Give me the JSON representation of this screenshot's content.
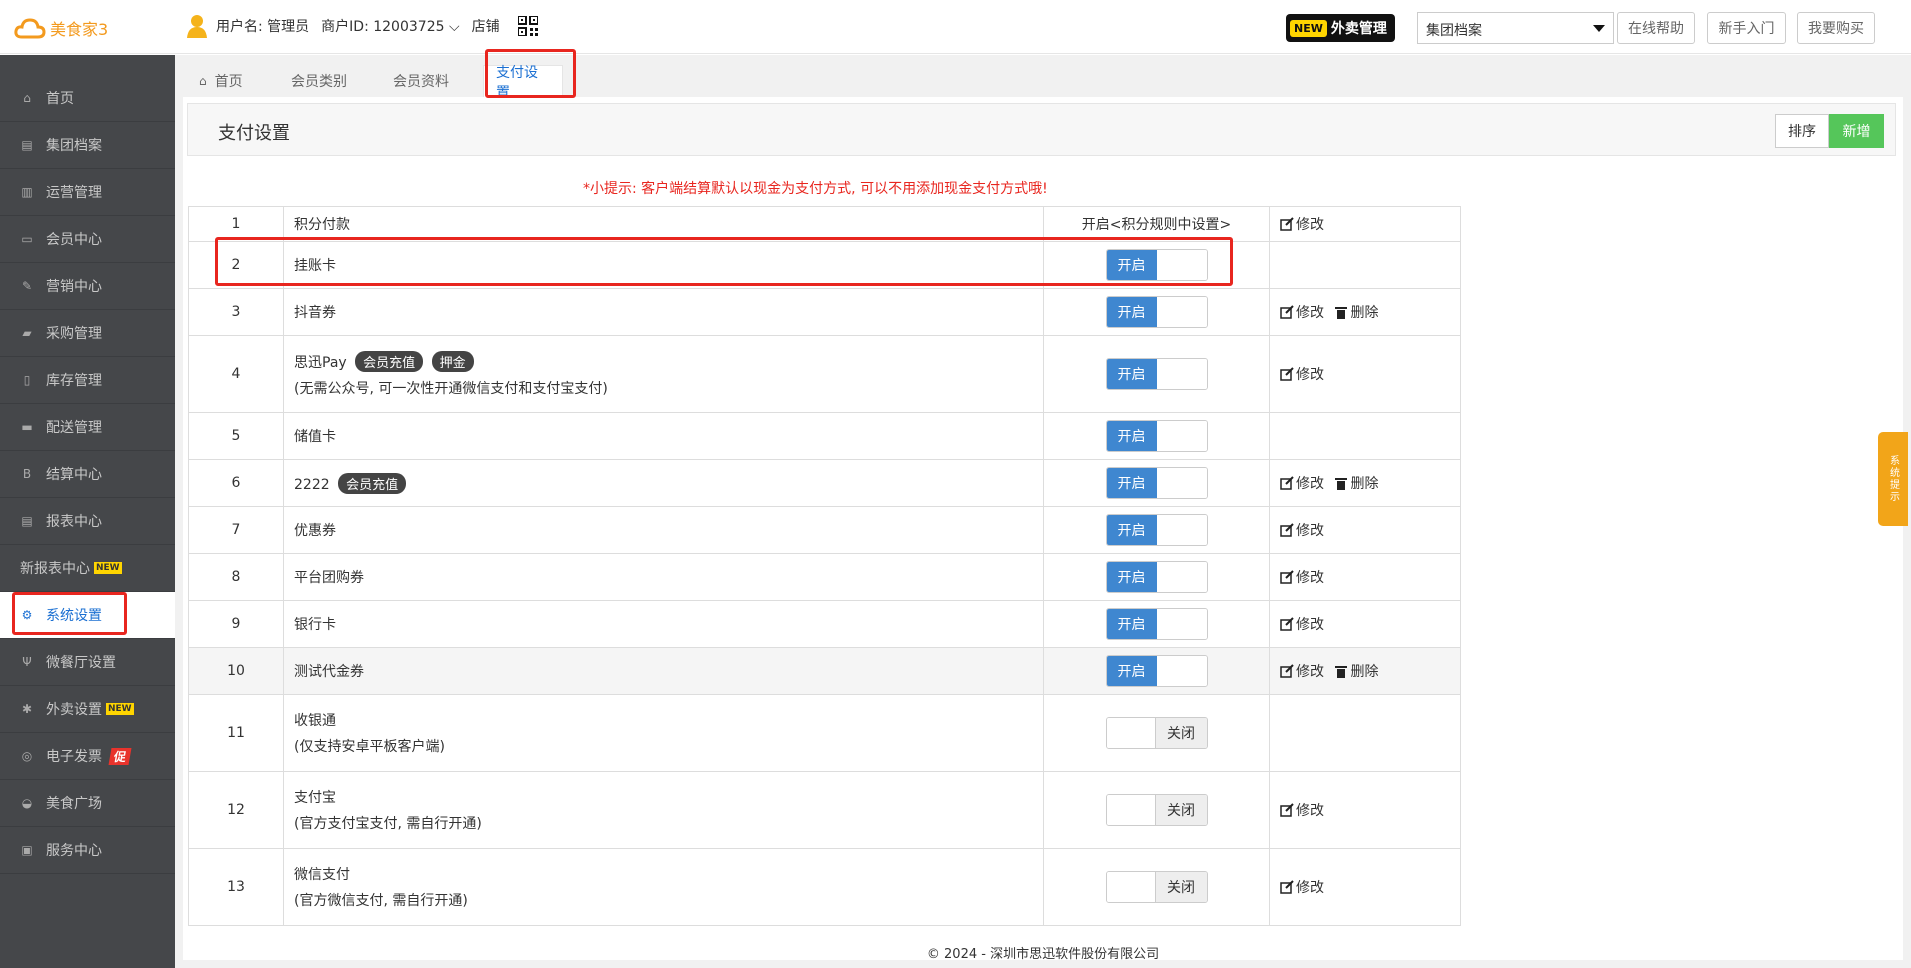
{
  "header": {
    "brand": "美食家3",
    "username_label": "用户名: 管理员",
    "merchant_label": "商户ID: 12003725 ⌵",
    "store_label": "店铺",
    "waimai_new": "NEW",
    "waimai_label": "外卖管理",
    "select_value": "集团档案",
    "help_label": "在线帮助",
    "intro_label": "新手入门",
    "buy_label": "我要购买"
  },
  "sidebar": {
    "items": [
      {
        "label": "首页",
        "icon": "home-icon"
      },
      {
        "label": "集团档案",
        "icon": "doc-icon"
      },
      {
        "label": "运营管理",
        "icon": "chart-icon"
      },
      {
        "label": "会员中心",
        "icon": "card-icon"
      },
      {
        "label": "营销中心",
        "icon": "edit-icon"
      },
      {
        "label": "采购管理",
        "icon": "book-icon"
      },
      {
        "label": "库存管理",
        "icon": "box-icon"
      },
      {
        "label": "配送管理",
        "icon": "truck-icon"
      },
      {
        "label": "结算中心",
        "icon": "coin-icon"
      },
      {
        "label": "报表中心",
        "icon": "report-icon"
      },
      {
        "label": "新报表中心",
        "badge": "NEW"
      },
      {
        "label": "系统设置",
        "icon": "gear-icon"
      },
      {
        "label": "微餐厅设置",
        "icon": "fork-icon"
      },
      {
        "label": "外卖设置",
        "icon": "cog-icon",
        "badge": "NEW"
      },
      {
        "label": "电子发票",
        "icon": "invoice-icon",
        "badge": "促"
      },
      {
        "label": "美食广场",
        "icon": "bowl-icon"
      },
      {
        "label": "服务中心",
        "icon": "service-icon"
      }
    ]
  },
  "tabs": [
    {
      "label": "首页"
    },
    {
      "label": "会员类别"
    },
    {
      "label": "会员资料"
    },
    {
      "label": "支付设置"
    }
  ],
  "panel": {
    "title": "支付设置",
    "sort_label": "排序",
    "add_label": "新增",
    "tip": "*小提示: 客户端结算默认以现金为支付方式, 可以不用添加现金支付方式哦!"
  },
  "labels": {
    "on": "开启",
    "off": "关闭",
    "edit": "修改",
    "delete": "删除"
  },
  "rows": [
    {
      "no": "1",
      "name": "积分付款",
      "status_text": "开启<积分规则中设置>"
    },
    {
      "no": "2",
      "name": "挂账卡"
    },
    {
      "no": "3",
      "name": "抖音券"
    },
    {
      "no": "4",
      "name": "思迅Pay",
      "tags": [
        "会员充值",
        "押金"
      ],
      "sub": "(无需公众号, 可一次性开通微信支付和支付宝支付)"
    },
    {
      "no": "5",
      "name": "储值卡"
    },
    {
      "no": "6",
      "name": "2222",
      "tags": [
        "会员充值"
      ]
    },
    {
      "no": "7",
      "name": "优惠券"
    },
    {
      "no": "8",
      "name": "平台团购券"
    },
    {
      "no": "9",
      "name": "银行卡"
    },
    {
      "no": "10",
      "name": "测试代金券"
    },
    {
      "no": "11",
      "name": "收银通",
      "sub": "(仅支持安卓平板客户端)"
    },
    {
      "no": "12",
      "name": "支付宝",
      "sub": "(官方支付宝支付, 需自行开通)"
    },
    {
      "no": "13",
      "name": "微信支付",
      "sub": "(官方微信支付, 需自行开通)"
    }
  ],
  "footer": "© 2024 - 深圳市思迅软件股份有限公司",
  "side_tip": "系统提示",
  "colors": {
    "accent": "#1a6fd2",
    "toggle_on": "#3f87d0",
    "add_green": "#55c65a",
    "highlight_red": "#e8261f",
    "sidebar_bg": "#45474a"
  }
}
